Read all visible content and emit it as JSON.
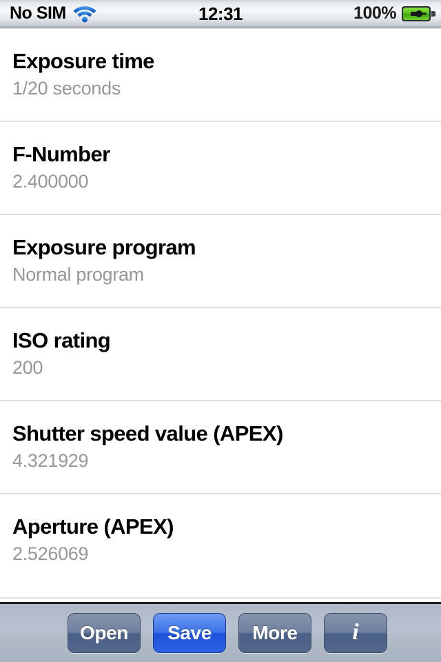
{
  "statusbar": {
    "carrier": "No SIM",
    "wifi_icon": "wifi-icon",
    "clock": "12:31",
    "battery_percent": "100%",
    "battery_icon": "battery-charging-icon",
    "battery_color": "#4fbf14"
  },
  "list": {
    "rows": [
      {
        "title": "Exposure time",
        "value": "1/20 seconds"
      },
      {
        "title": "F-Number",
        "value": "2.400000"
      },
      {
        "title": "Exposure program",
        "value": "Normal program"
      },
      {
        "title": "ISO rating",
        "value": "200"
      },
      {
        "title": "Shutter speed value (APEX)",
        "value": "4.321929"
      },
      {
        "title": "Aperture (APEX)",
        "value": "2.526069"
      }
    ]
  },
  "toolbar": {
    "open_label": "Open",
    "save_label": "Save",
    "more_label": "More",
    "info_glyph": "i",
    "info_icon": "info-icon",
    "primary_color": "#2f63e4"
  }
}
